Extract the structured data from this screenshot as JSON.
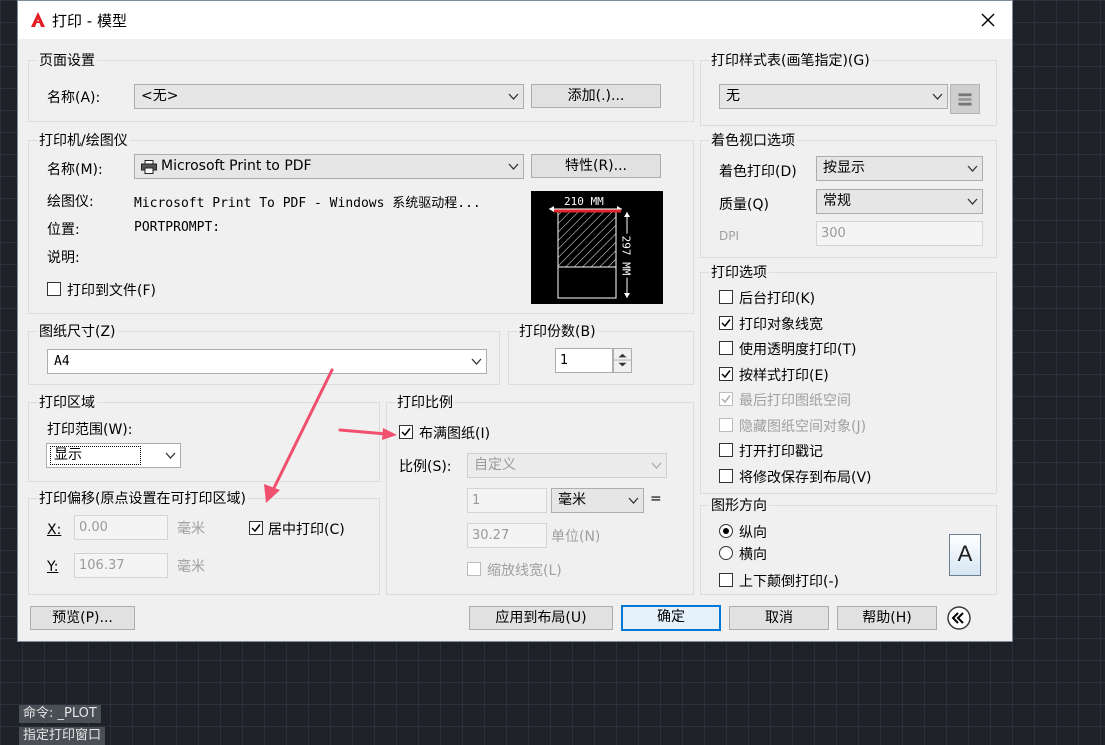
{
  "window": {
    "title": "打印 - 模型"
  },
  "page_setup": {
    "group": "页面设置",
    "name_label": "名称(A):",
    "name_value": "<无>",
    "add_button": "添加(.)..."
  },
  "printer": {
    "group": "打印机/绘图仪",
    "name_label": "名称(M):",
    "name_value": "Microsoft Print to PDF",
    "properties_button": "特性(R)...",
    "plotter_label": "绘图仪:",
    "plotter_value": "Microsoft Print To PDF - Windows 系统驱动程...",
    "location_label": "位置:",
    "location_value": "PORTPROMPT:",
    "desc_label": "说明:",
    "print_to_file": "打印到文件(F)",
    "print_to_file_checked": false,
    "preview": {
      "width": "210 MM",
      "height": "297 MM"
    }
  },
  "paper_size": {
    "group": "图纸尺寸(Z)",
    "value": "A4"
  },
  "copies": {
    "group": "打印份数(B)",
    "value": "1"
  },
  "plot_area": {
    "group": "打印区域",
    "range_label": "打印范围(W):",
    "range_value": "显示"
  },
  "plot_offset": {
    "group": "打印偏移(原点设置在可打印区域)",
    "x_label": "X:",
    "x_value": "0.00",
    "x_unit": "毫米",
    "y_label": "Y:",
    "y_value": "106.37",
    "y_unit": "毫米",
    "center": "居中打印(C)",
    "center_checked": true
  },
  "plot_scale": {
    "group": "打印比例",
    "fit": "布满图纸(I)",
    "fit_checked": true,
    "scale_label": "比例(S):",
    "scale_value": "自定义",
    "value1": "1",
    "unit_value": "毫米",
    "equals": "=",
    "value2": "30.27",
    "unit_label": "单位(N)",
    "scale_lineweights": "缩放线宽(L)"
  },
  "plot_style": {
    "group": "打印样式表(画笔指定)(G)",
    "value": "无"
  },
  "shaded_viewport": {
    "group": "着色视口选项",
    "shade_label": "着色打印(D)",
    "shade_value": "按显示",
    "quality_label": "质量(Q)",
    "quality_value": "常规",
    "dpi_label": "DPI",
    "dpi_value": "300"
  },
  "plot_options": {
    "group": "打印选项",
    "items": [
      {
        "label": "后台打印(K)",
        "checked": false,
        "disabled": false
      },
      {
        "label": "打印对象线宽",
        "checked": true,
        "disabled": false
      },
      {
        "label": "使用透明度打印(T)",
        "checked": false,
        "disabled": false
      },
      {
        "label": "按样式打印(E)",
        "checked": true,
        "disabled": false
      },
      {
        "label": "最后打印图纸空间",
        "checked": true,
        "disabled": true
      },
      {
        "label": "隐藏图纸空间对象(J)",
        "checked": false,
        "disabled": true
      },
      {
        "label": "打开打印戳记",
        "checked": false,
        "disabled": false
      },
      {
        "label": "将修改保存到布局(V)",
        "checked": false,
        "disabled": false
      }
    ]
  },
  "orientation": {
    "group": "图形方向",
    "portrait": "纵向",
    "landscape": "横向",
    "selected": "portrait",
    "upside_down": "上下颠倒打印(-)",
    "icon_letter": "A"
  },
  "footer": {
    "preview": "预览(P)...",
    "apply": "应用到布局(U)",
    "ok": "确定",
    "cancel": "取消",
    "help": "帮助(H)"
  },
  "command_line": {
    "line1": "命令: _PLOT",
    "line2": "指定打印窗口"
  },
  "colors": {
    "annotation_arrow": "#f0506e",
    "focus": "#0078d7"
  }
}
